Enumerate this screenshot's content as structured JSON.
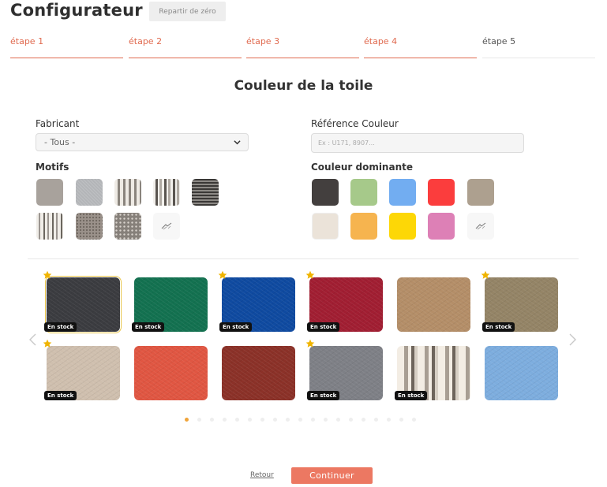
{
  "header": {
    "title": "Configurateur",
    "reset_label": "Repartir de zéro"
  },
  "steps": [
    "étape 1",
    "étape 2",
    "étape 3",
    "étape 4",
    "étape 5"
  ],
  "section_title": "Couleur de la toile",
  "filters": {
    "manufacturer_label": "Fabricant",
    "manufacturer_value": "- Tous -",
    "color_ref_label": "Référence Couleur",
    "color_ref_placeholder": "Ex : U171, 8907...",
    "patterns_label": "Motifs",
    "dominant_color_label": "Couleur dominante",
    "dominant_colors": [
      "#433f3e",
      "#a6c98a",
      "#72adf1",
      "#fb3d3d",
      "#ada08f",
      "#ebe3d9",
      "#f6b44f",
      "#fdd706",
      "#dd80b6"
    ]
  },
  "fabrics": {
    "stock_label": "En stock",
    "items": [
      {
        "color": "#3b3c40",
        "in_stock": true,
        "starred": true,
        "selected": true
      },
      {
        "color": "#137150",
        "in_stock": true,
        "starred": false
      },
      {
        "color": "#0f4aa0",
        "in_stock": true,
        "starred": true
      },
      {
        "color": "#a11e32",
        "in_stock": true,
        "starred": true
      },
      {
        "color": "#b48e68",
        "in_stock": false,
        "starred": false
      },
      {
        "color": "#948466",
        "in_stock": true,
        "starred": true
      },
      {
        "color": "#cfbfae",
        "in_stock": true,
        "starred": true
      },
      {
        "color": "#e05642",
        "in_stock": false,
        "starred": false
      },
      {
        "color": "#8b3128",
        "in_stock": false,
        "starred": false
      },
      {
        "color": "#7e8086",
        "in_stock": true,
        "starred": true
      },
      {
        "color": "striped",
        "in_stock": true,
        "starred": false
      },
      {
        "color": "#7dadde",
        "in_stock": false,
        "starred": false
      }
    ]
  },
  "pagination": {
    "pages": 19,
    "current": 1
  },
  "footer": {
    "back_label": "Retour",
    "continue_label": "Continuer"
  },
  "colors": {
    "accent": "#ec7862",
    "step_active": "#e06a4f",
    "star": "#f0b400"
  }
}
